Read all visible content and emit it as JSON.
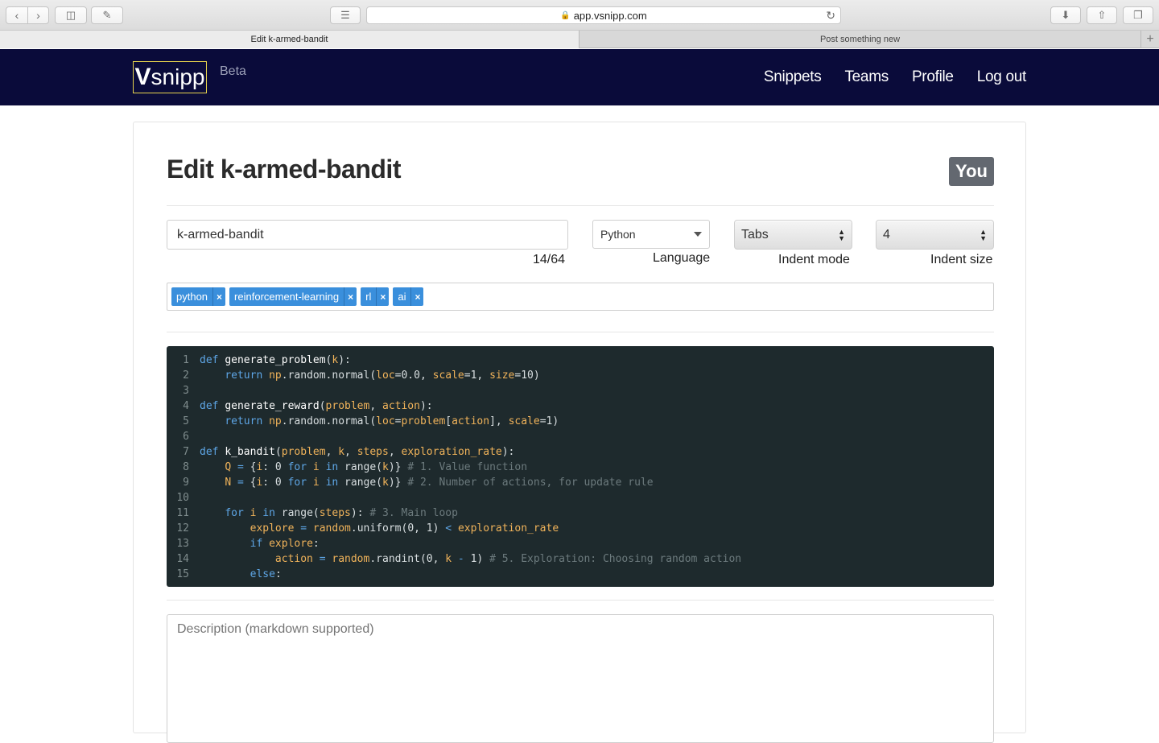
{
  "browser": {
    "url": "app.vsnipp.com",
    "tabs": [
      {
        "label": "Edit k-armed-bandit",
        "active": true
      },
      {
        "label": "Post something new",
        "active": false
      }
    ]
  },
  "navbar": {
    "logo_v": "V",
    "logo_rest": "snipp",
    "beta": "Beta",
    "links": [
      "Snippets",
      "Teams",
      "Profile",
      "Log out"
    ]
  },
  "editor_page": {
    "title": "Edit k-armed-bandit",
    "owner_badge": "You",
    "name_value": "k-armed-bandit",
    "char_count": "14/64",
    "language": {
      "value": "Python",
      "label": "Language"
    },
    "indent_mode": {
      "value": "Tabs",
      "label": "Indent mode"
    },
    "indent_size": {
      "value": "4",
      "label": "Indent size"
    },
    "tags": [
      "python",
      "reinforcement-learning",
      "rl",
      "ai"
    ],
    "description_placeholder": "Description (markdown supported)"
  },
  "colors": {
    "navbar_bg": "#0a0b3a",
    "logo_border": "#e8d44d",
    "tag_bg": "#3a8fdc",
    "editor_bg": "#1e2a2d",
    "keyword": "#5ea6e6",
    "param": "#f0b35a",
    "comment": "#6c7a7d"
  },
  "icons": [
    "back-icon",
    "forward-icon",
    "sidebar-icon",
    "pen-icon",
    "reader-icon",
    "lock-icon",
    "reload-icon",
    "download-icon",
    "share-icon",
    "tabs-icon",
    "plus-icon",
    "caret-down-icon",
    "updown-arrows-icon",
    "close-icon"
  ],
  "code": {
    "line_numbers": [
      "1",
      "2",
      "3",
      "4",
      "5",
      "6",
      "7",
      "8",
      "9",
      "10",
      "11",
      "12",
      "13",
      "14",
      "15"
    ],
    "lines": [
      [
        [
          "k",
          "def"
        ],
        [
          "n",
          " "
        ],
        [
          "f",
          "generate_problem"
        ],
        [
          "n",
          "("
        ],
        [
          "p",
          "k"
        ],
        [
          "n",
          "):"
        ]
      ],
      [
        [
          "n",
          "    "
        ],
        [
          "k",
          "return"
        ],
        [
          "n",
          " "
        ],
        [
          "p",
          "np"
        ],
        [
          "n",
          ".random.normal("
        ],
        [
          "p",
          "loc"
        ],
        [
          "n",
          "=0.0, "
        ],
        [
          "p",
          "scale"
        ],
        [
          "n",
          "=1, "
        ],
        [
          "p",
          "size"
        ],
        [
          "n",
          "=10)"
        ]
      ],
      [],
      [
        [
          "k",
          "def"
        ],
        [
          "n",
          " "
        ],
        [
          "f",
          "generate_reward"
        ],
        [
          "n",
          "("
        ],
        [
          "p",
          "problem"
        ],
        [
          "n",
          ", "
        ],
        [
          "p",
          "action"
        ],
        [
          "n",
          "):"
        ]
      ],
      [
        [
          "n",
          "    "
        ],
        [
          "k",
          "return"
        ],
        [
          "n",
          " "
        ],
        [
          "p",
          "np"
        ],
        [
          "n",
          ".random.normal("
        ],
        [
          "p",
          "loc"
        ],
        [
          "n",
          "="
        ],
        [
          "p",
          "problem"
        ],
        [
          "n",
          "["
        ],
        [
          "p",
          "action"
        ],
        [
          "n",
          "], "
        ],
        [
          "p",
          "scale"
        ],
        [
          "n",
          "=1)"
        ]
      ],
      [],
      [
        [
          "k",
          "def"
        ],
        [
          "n",
          " "
        ],
        [
          "f",
          "k_bandit"
        ],
        [
          "n",
          "("
        ],
        [
          "p",
          "problem"
        ],
        [
          "n",
          ", "
        ],
        [
          "p",
          "k"
        ],
        [
          "n",
          ", "
        ],
        [
          "p",
          "steps"
        ],
        [
          "n",
          ", "
        ],
        [
          "p",
          "exploration_rate"
        ],
        [
          "n",
          "):"
        ]
      ],
      [
        [
          "n",
          "    "
        ],
        [
          "p",
          "Q"
        ],
        [
          "n",
          " "
        ],
        [
          "k",
          "="
        ],
        [
          "n",
          " {"
        ],
        [
          "p",
          "i"
        ],
        [
          "n",
          ": 0 "
        ],
        [
          "k",
          "for"
        ],
        [
          "n",
          " "
        ],
        [
          "p",
          "i"
        ],
        [
          "n",
          " "
        ],
        [
          "k",
          "in"
        ],
        [
          "n",
          " range("
        ],
        [
          "p",
          "k"
        ],
        [
          "n",
          ")} "
        ],
        [
          "c",
          "# 1. Value function"
        ]
      ],
      [
        [
          "n",
          "    "
        ],
        [
          "p",
          "N"
        ],
        [
          "n",
          " "
        ],
        [
          "k",
          "="
        ],
        [
          "n",
          " {"
        ],
        [
          "p",
          "i"
        ],
        [
          "n",
          ": 0 "
        ],
        [
          "k",
          "for"
        ],
        [
          "n",
          " "
        ],
        [
          "p",
          "i"
        ],
        [
          "n",
          " "
        ],
        [
          "k",
          "in"
        ],
        [
          "n",
          " range("
        ],
        [
          "p",
          "k"
        ],
        [
          "n",
          ")} "
        ],
        [
          "c",
          "# 2. Number of actions, for update rule"
        ]
      ],
      [],
      [
        [
          "n",
          "    "
        ],
        [
          "k",
          "for"
        ],
        [
          "n",
          " "
        ],
        [
          "p",
          "i"
        ],
        [
          "n",
          " "
        ],
        [
          "k",
          "in"
        ],
        [
          "n",
          " range("
        ],
        [
          "p",
          "steps"
        ],
        [
          "n",
          "): "
        ],
        [
          "c",
          "# 3. Main loop"
        ]
      ],
      [
        [
          "n",
          "        "
        ],
        [
          "p",
          "explore"
        ],
        [
          "n",
          " "
        ],
        [
          "k",
          "="
        ],
        [
          "n",
          " "
        ],
        [
          "p",
          "random"
        ],
        [
          "n",
          ".uniform(0, 1) "
        ],
        [
          "k",
          "<"
        ],
        [
          "n",
          " "
        ],
        [
          "p",
          "exploration_rate"
        ]
      ],
      [
        [
          "n",
          "        "
        ],
        [
          "k",
          "if"
        ],
        [
          "n",
          " "
        ],
        [
          "p",
          "explore"
        ],
        [
          "n",
          ":"
        ]
      ],
      [
        [
          "n",
          "            "
        ],
        [
          "p",
          "action"
        ],
        [
          "n",
          " "
        ],
        [
          "k",
          "="
        ],
        [
          "n",
          " "
        ],
        [
          "p",
          "random"
        ],
        [
          "n",
          ".randint(0, "
        ],
        [
          "p",
          "k"
        ],
        [
          "n",
          " "
        ],
        [
          "k",
          "-"
        ],
        [
          "n",
          " 1) "
        ],
        [
          "c",
          "# 5. Exploration: Choosing random action"
        ]
      ],
      [
        [
          "n",
          "        "
        ],
        [
          "k",
          "else"
        ],
        [
          "n",
          ":"
        ]
      ]
    ]
  }
}
